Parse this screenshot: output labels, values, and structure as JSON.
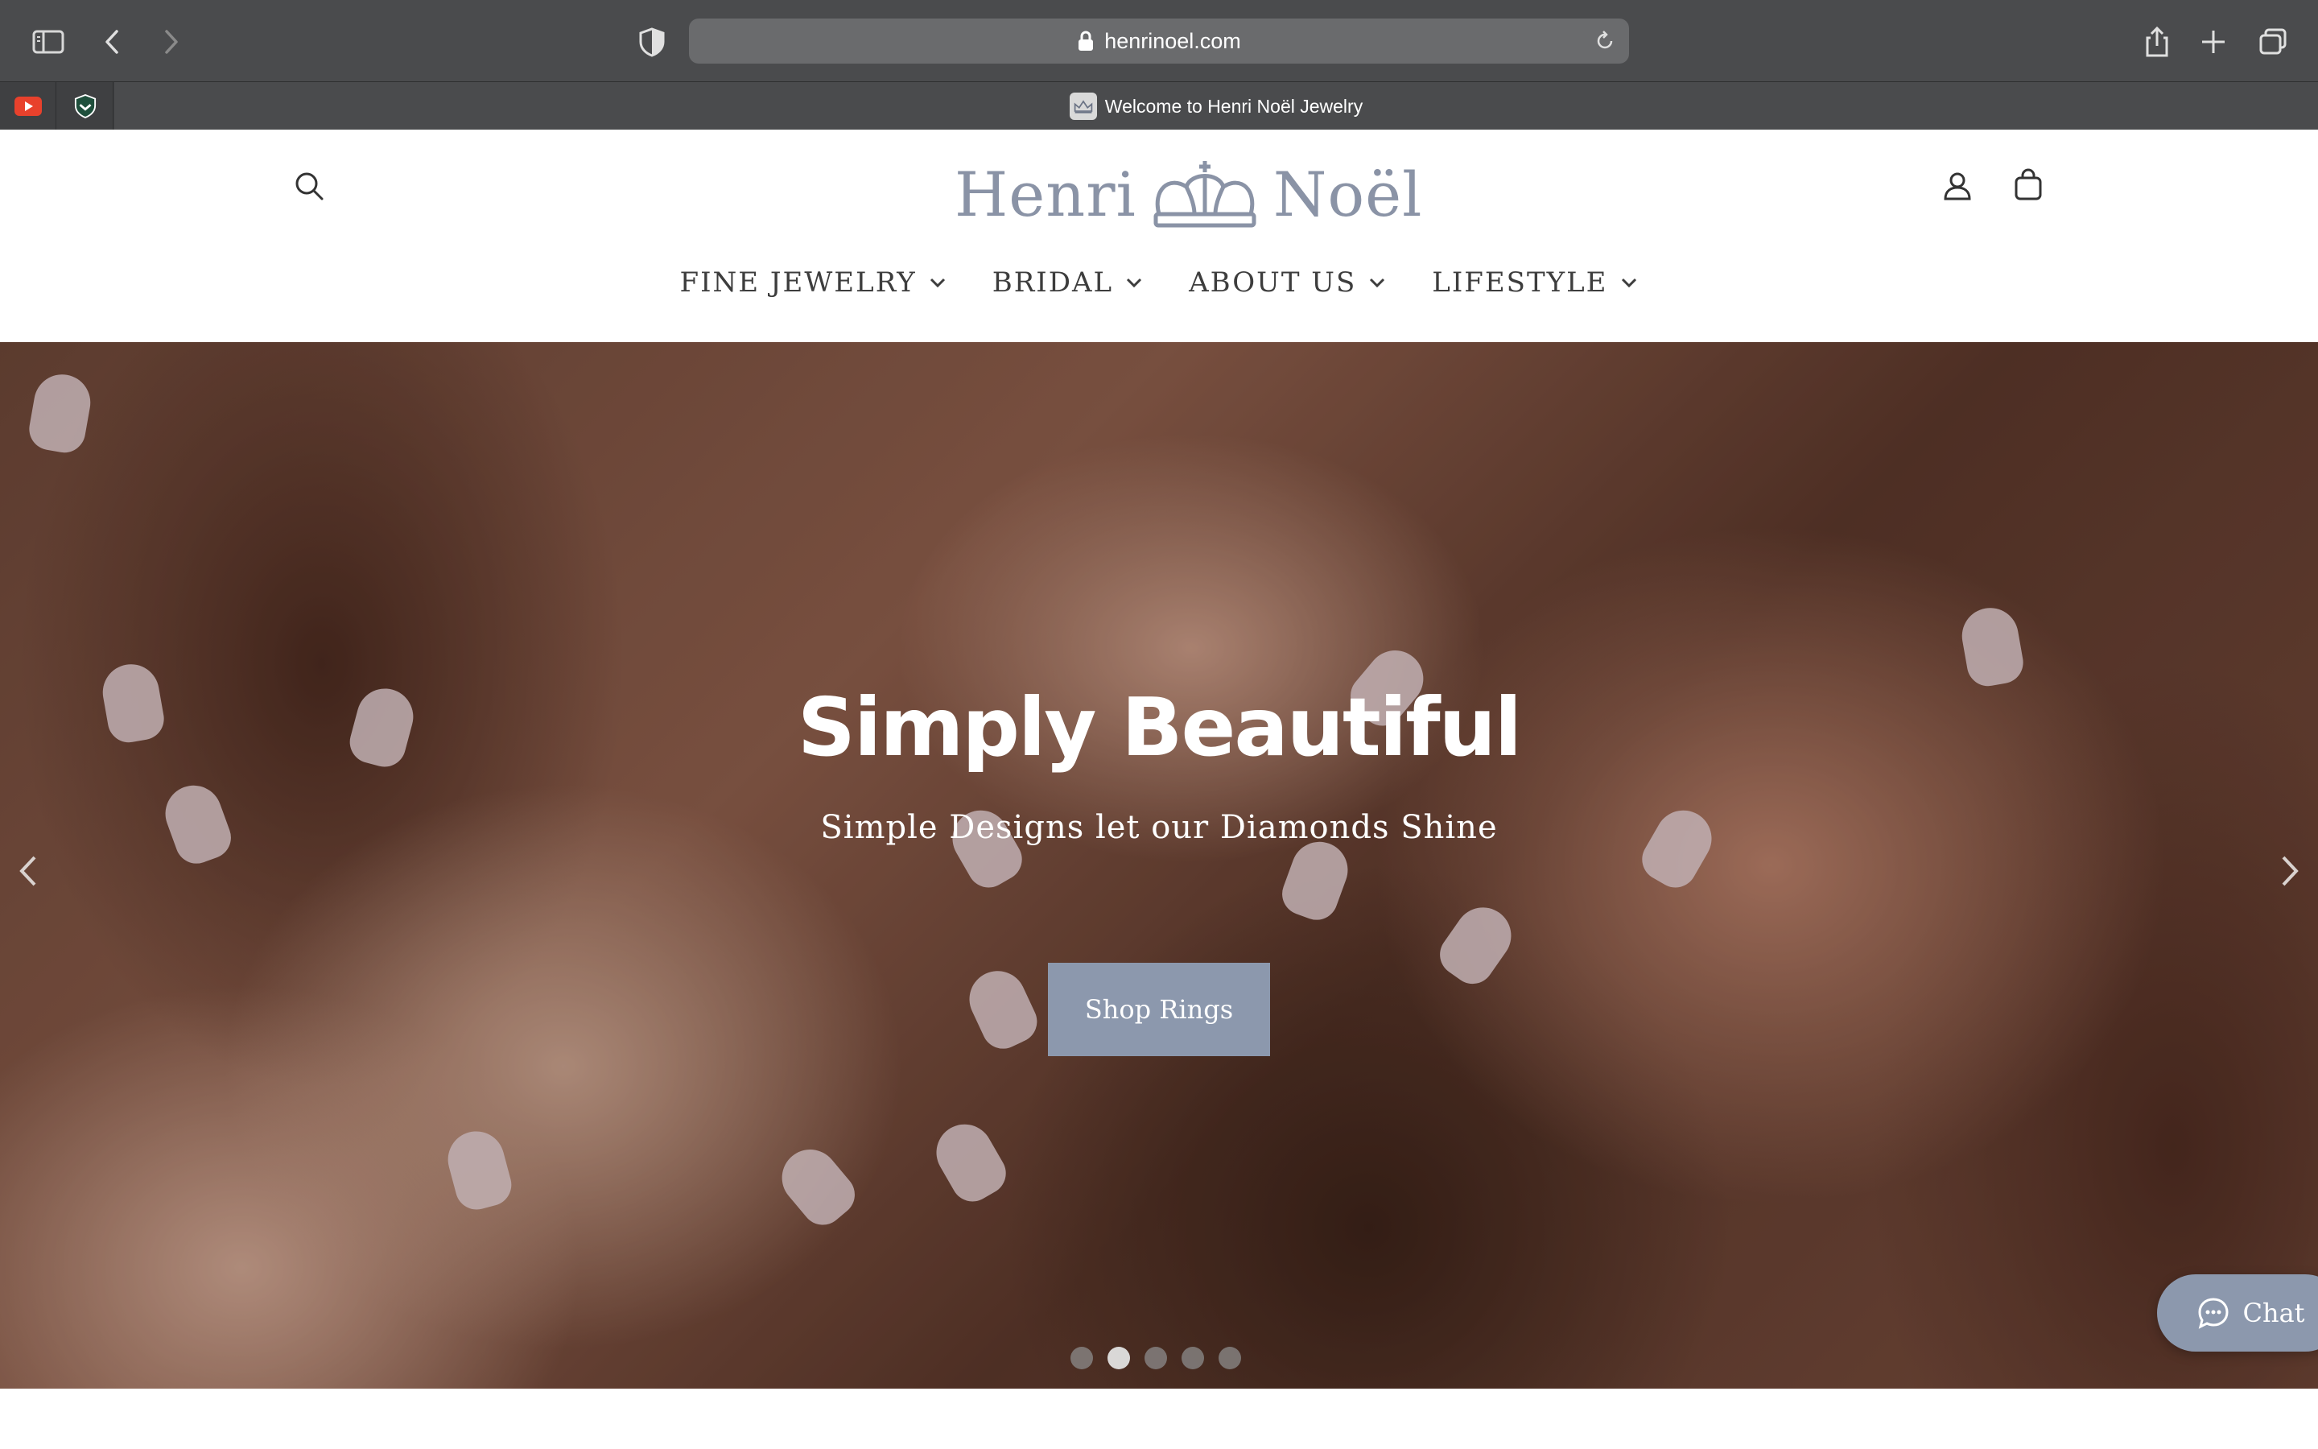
{
  "browser": {
    "url": "henrinoel.com",
    "active_tab_title": "Welcome to Henri Noël Jewelry",
    "pinned_tabs": [
      "youtube-favicon",
      "shield-favicon"
    ],
    "icons": [
      "sidebar-icon",
      "back-icon",
      "forward-icon",
      "privacy-shield-icon",
      "lock-icon",
      "reload-icon",
      "share-icon",
      "new-tab-icon",
      "tab-overview-icon"
    ]
  },
  "header": {
    "logo_left": "Henri",
    "logo_right": "Noël",
    "icons": [
      "search-icon",
      "account-icon",
      "cart-icon"
    ],
    "nav": [
      {
        "label": "FINE JEWELRY"
      },
      {
        "label": "BRIDAL"
      },
      {
        "label": "ABOUT US"
      },
      {
        "label": "LIFESTYLE"
      }
    ]
  },
  "hero": {
    "title": "Simply Beautiful",
    "subtitle": "Simple Designs let our Diamonds Shine",
    "cta_label": "Shop Rings",
    "slide_count": 5,
    "active_slide": 2
  },
  "chat": {
    "label": "Chat"
  },
  "colors": {
    "accent": "#8c98ad",
    "logo": "#8a93a6",
    "chrome": "#4a4b4d"
  }
}
